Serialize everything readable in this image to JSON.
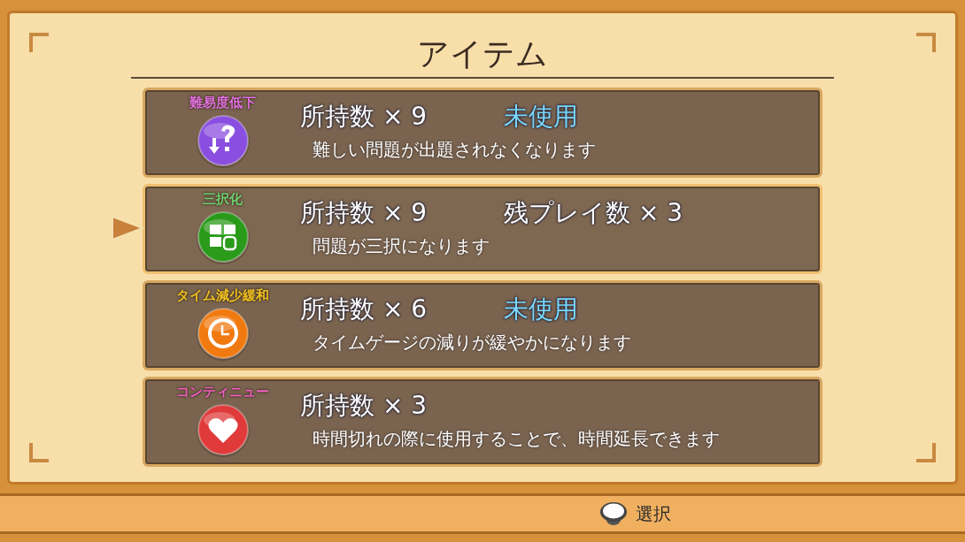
{
  "title": "アイテム",
  "items": [
    {
      "label": "難易度低下",
      "color": "#e070e0",
      "kind": "question",
      "count": "所持数 × 9",
      "status": {
        "kind": "unused",
        "text": "未使用"
      },
      "description": "難しい問題が出題されなくなります",
      "selected": false
    },
    {
      "label": "三択化",
      "color": "#70d070",
      "kind": "grid",
      "count": "所持数 × 9",
      "status": {
        "kind": "remaining",
        "text": "残プレイ数 × 3"
      },
      "description": "問題が三択になります",
      "selected": true
    },
    {
      "label": "タイム減少緩和",
      "color": "#f0c020",
      "kind": "clock",
      "count": "所持数 × 6",
      "status": {
        "kind": "unused",
        "text": "未使用"
      },
      "description": "タイムゲージの減りが緩やかになります",
      "selected": false
    },
    {
      "label": "コンティニュー",
      "color": "#f060c0",
      "kind": "heart",
      "count": "所持数 × 3",
      "description": "時間切れの際に使用することで、時間延長できます",
      "selected": false
    }
  ],
  "footer": {
    "hint": "選択"
  }
}
